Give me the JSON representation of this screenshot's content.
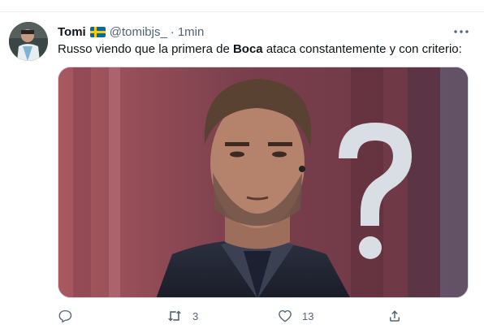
{
  "tweet": {
    "author_name": "Tomi",
    "flag_icon": "sweden-flag-icon",
    "handle": "@tomibjs_",
    "separator": "·",
    "time": "1min",
    "text_before": "Russo viendo que la primera de ",
    "text_bold": "Boca",
    "text_after": " ataca constantemente y con criterio:",
    "media": {
      "subject": "man-with-question-mark-meme",
      "icon": "question-mark-icon"
    }
  },
  "actions": {
    "reply": {
      "icon": "reply-icon",
      "count": ""
    },
    "retweet": {
      "icon": "retweet-icon",
      "count": "3"
    },
    "like": {
      "icon": "heart-icon",
      "count": "13"
    },
    "share": {
      "icon": "share-icon",
      "count": ""
    }
  },
  "colors": {
    "text": "#0f1419",
    "secondary": "#536471",
    "border": "#cfd9de",
    "flag_blue": "#006aa7",
    "flag_yellow": "#fecc00"
  }
}
